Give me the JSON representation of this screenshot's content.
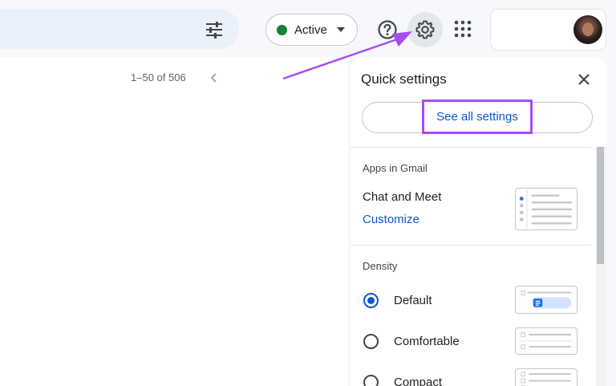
{
  "topbar": {
    "status_label": "Active",
    "icons": [
      "filter-icon",
      "help-icon",
      "gear-icon",
      "apps-icon"
    ]
  },
  "mail": {
    "pager_text": "1–50 of 506"
  },
  "quick_settings": {
    "title": "Quick settings",
    "see_all_label": "See all settings",
    "apps_heading": "Apps in Gmail",
    "chat_meet_label": "Chat and Meet",
    "customize_label": "Customize",
    "density_heading": "Density",
    "density_options": [
      {
        "label": "Default",
        "selected": true
      },
      {
        "label": "Comfortable",
        "selected": false
      },
      {
        "label": "Compact",
        "selected": false
      }
    ]
  },
  "colors": {
    "accent": "#0b57d0",
    "highlight": "#a64df0",
    "status_green": "#188038"
  }
}
